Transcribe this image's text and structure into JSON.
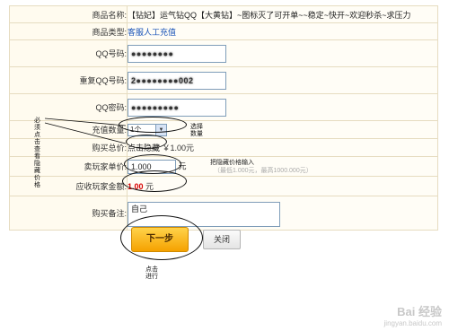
{
  "form": {
    "product_name_label": "商品名称:",
    "product_name_value": "【钻妃】运气钻QQ【大黄钻】~图标灭了可开单~~稳定~快开~欢迎秒杀~求压力",
    "product_type_label": "商品类型:",
    "product_type_value": "客服人工充值",
    "qq_label": "QQ号码:",
    "qq_value": "●●●●●●●●",
    "qq_repeat_label": "重复QQ号码:",
    "qq_repeat_value": "2●●●●●●●●002",
    "qq_pass_label": "QQ密码:",
    "qq_pass_value": "●●●●●●●●●",
    "qty_label": "充值数量:",
    "qty_value": "1个",
    "qty_note": "选择数量",
    "price_label": "购买总价:",
    "price_hint": "点击隐藏",
    "price_value": "￥1.00元",
    "unit_label": "卖玩家单价:",
    "unit_value": "1.000",
    "unit_note": "把隐藏价格输入",
    "unit_faint": "（最低1.000元，最高1000.000元）",
    "unit_suffix": "元",
    "due_label": "应收玩家金额:",
    "due_value": "1.00",
    "due_unit": "元",
    "remark_label": "购买备注:",
    "remark_value": "自己"
  },
  "annotations": {
    "left_note": "必须点击查看隐藏价格",
    "click_note": "点击进行"
  },
  "buttons": {
    "buy": "下一步",
    "close": "关闭"
  },
  "watermark": {
    "brand": "Bai 经验",
    "url": "jingyan.baidu.com"
  }
}
